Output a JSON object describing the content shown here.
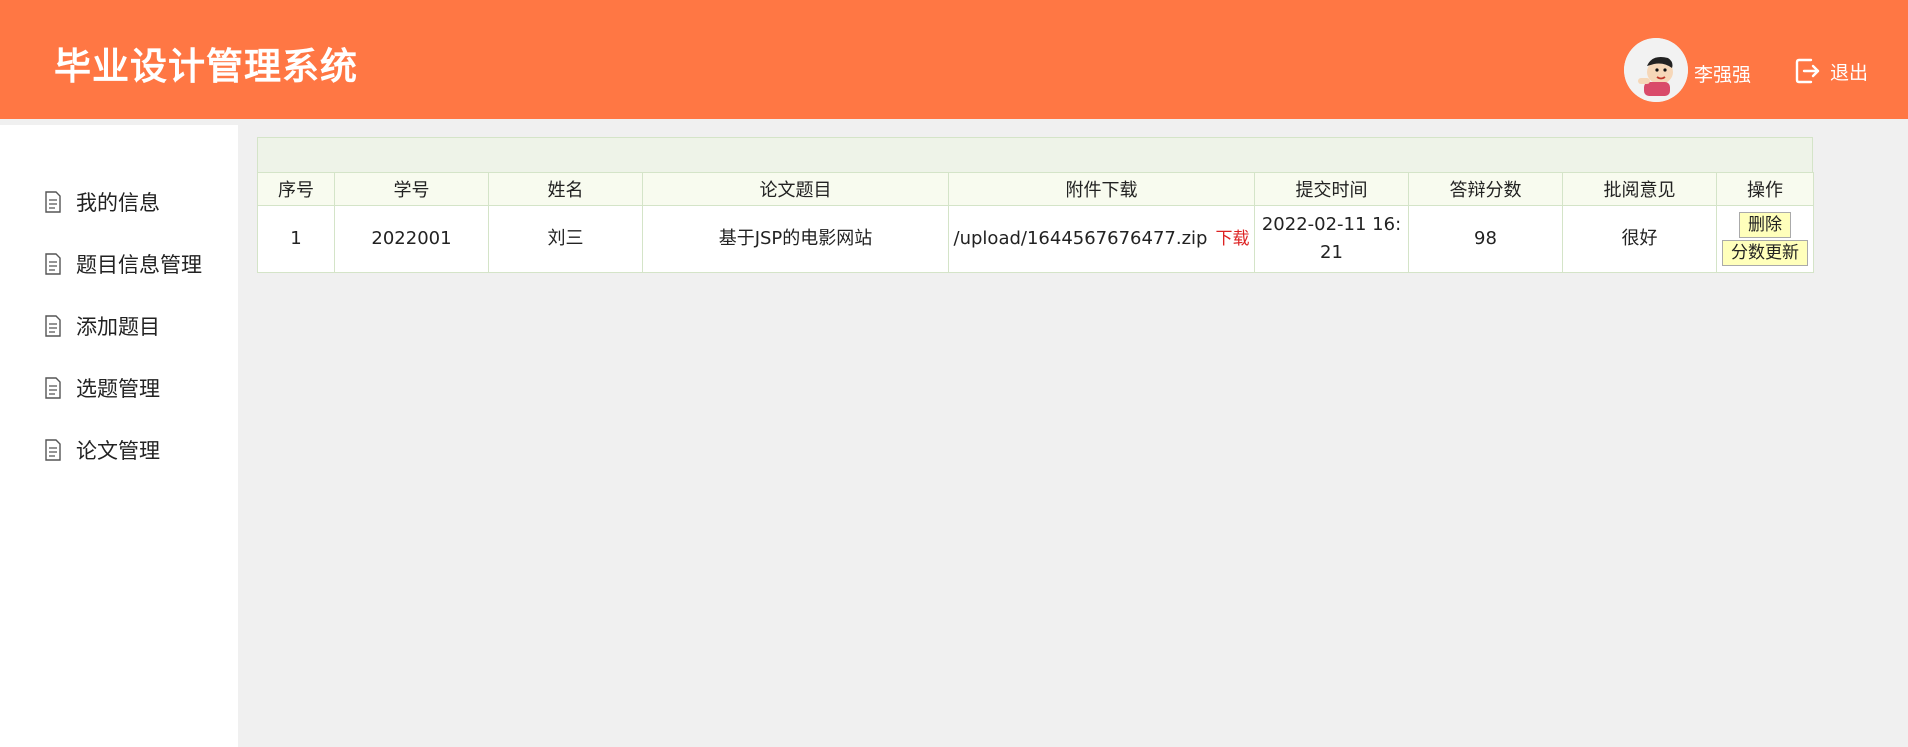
{
  "header": {
    "title": "毕业设计管理系统",
    "user_name": "李强强",
    "logout_label": "退出"
  },
  "sidebar": {
    "items": [
      {
        "label": "我的信息",
        "icon": "document-icon"
      },
      {
        "label": "题目信息管理",
        "icon": "document-icon"
      },
      {
        "label": "添加题目",
        "icon": "document-icon"
      },
      {
        "label": "选题管理",
        "icon": "document-icon"
      },
      {
        "label": "论文管理",
        "icon": "document-icon"
      }
    ]
  },
  "table": {
    "columns": [
      "序号",
      "学号",
      "姓名",
      "论文题目",
      "附件下载",
      "提交时间",
      "答辩分数",
      "批阅意见",
      "操作"
    ],
    "rows": [
      {
        "index": "1",
        "student_id": "2022001",
        "name": "刘三",
        "thesis_title": "基于JSP的电影网站",
        "file_path": "/upload/1644567676477.zip",
        "download_label": "下载",
        "submit_time": "2022-02-11 16:21",
        "score": "98",
        "comment": "很好",
        "delete_label": "删除",
        "update_score_label": "分数更新"
      }
    ]
  },
  "colors": {
    "header_bg": "#ff7744",
    "download_link": "#dd2222",
    "button_bg": "#ffffbb"
  }
}
